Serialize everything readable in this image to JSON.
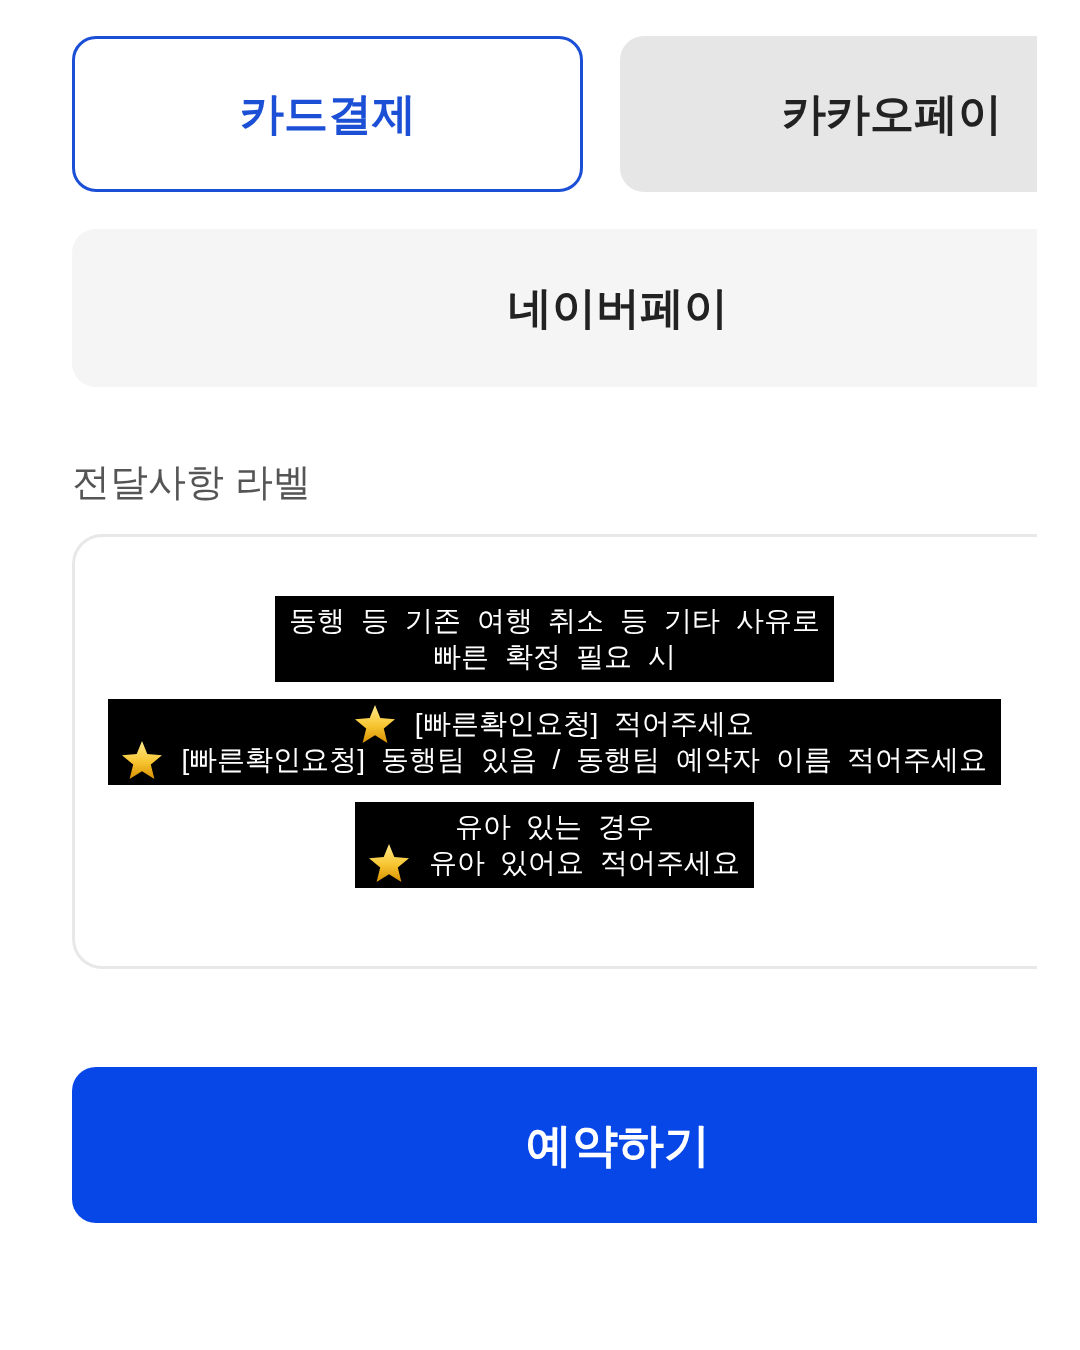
{
  "payment_methods": [
    {
      "label": "카드결제",
      "selected": true,
      "pressed": false
    },
    {
      "label": "카카오페이",
      "selected": false,
      "pressed": true
    },
    {
      "label": "네이버페이",
      "selected": false,
      "pressed": false
    }
  ],
  "message_field": {
    "label": "전달사항 라벨"
  },
  "captions": [
    {
      "lines": [
        {
          "star": false,
          "text": "동행 등 기존 여행 취소 등 기타 사유로"
        },
        {
          "star": false,
          "text": "빠른 확정 필요 시"
        }
      ]
    },
    {
      "lines": [
        {
          "star": true,
          "text": "[빠른확인요청] 적어주세요"
        },
        {
          "star": true,
          "text": "[빠른확인요청] 동행팀 있음 / 동행팀 예약자 이름 적어주세요"
        }
      ]
    },
    {
      "lines": [
        {
          "star": false,
          "text": "유아 있는 경우"
        },
        {
          "star": true,
          "text": "유아 있어요 적어주세요"
        }
      ]
    }
  ],
  "submit_button": {
    "label": "예약하기"
  }
}
